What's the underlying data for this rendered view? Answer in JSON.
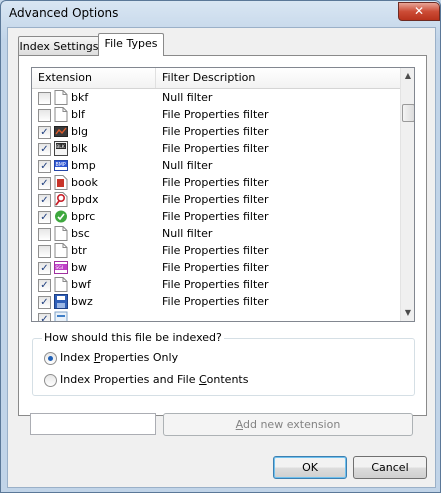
{
  "window": {
    "title": "Advanced Options",
    "close_symbol": "✕"
  },
  "tabs": [
    {
      "label": "Index Settings",
      "active": false
    },
    {
      "label": "File Types",
      "active": true
    }
  ],
  "list": {
    "header_extension": "Extension",
    "header_description": "Filter Description",
    "rows": [
      {
        "checked": false,
        "icon": "blank-file-icon",
        "ext": "bkf",
        "desc": "Null filter"
      },
      {
        "checked": false,
        "icon": "blank-file-icon",
        "ext": "blf",
        "desc": "File Properties filter"
      },
      {
        "checked": true,
        "icon": "blg-file-icon",
        "ext": "blg",
        "desc": "File Properties filter"
      },
      {
        "checked": true,
        "icon": "blk-file-icon",
        "ext": "blk",
        "desc": "File Properties filter"
      },
      {
        "checked": true,
        "icon": "bmp-file-icon",
        "ext": "bmp",
        "desc": "Null filter"
      },
      {
        "checked": true,
        "icon": "book-file-icon",
        "ext": "book",
        "desc": "File Properties filter"
      },
      {
        "checked": true,
        "icon": "bpdx-file-icon",
        "ext": "bpdx",
        "desc": "File Properties filter"
      },
      {
        "checked": true,
        "icon": "bprc-file-icon",
        "ext": "bprc",
        "desc": "File Properties filter"
      },
      {
        "checked": false,
        "icon": "blank-file-icon",
        "ext": "bsc",
        "desc": "Null filter"
      },
      {
        "checked": false,
        "icon": "blank-file-icon",
        "ext": "btr",
        "desc": "File Properties filter"
      },
      {
        "checked": true,
        "icon": "bw-file-icon",
        "ext": "bw",
        "desc": "File Properties filter"
      },
      {
        "checked": true,
        "icon": "blank-file-icon",
        "ext": "bwf",
        "desc": "File Properties filter"
      },
      {
        "checked": true,
        "icon": "bwz-file-icon",
        "ext": "bwz",
        "desc": "File Properties filter"
      },
      {
        "checked": true,
        "icon": "generic-file-icon",
        "ext": "",
        "desc": ""
      }
    ],
    "check_mark": "✓"
  },
  "index_group": {
    "legend": "How should this file be indexed?",
    "option1_pre": "Index ",
    "option1_u": "P",
    "option1_post": "roperties Only",
    "option2_pre": "Index Properties and File ",
    "option2_u": "C",
    "option2_post": "ontents",
    "selected": "option1"
  },
  "new_extension": {
    "value": "",
    "button_pre": "",
    "button_u": "A",
    "button_post": "dd new extension"
  },
  "footer": {
    "ok_label": "OK",
    "cancel_label": "Cancel"
  },
  "colors": {
    "accent": "#1f5fb5",
    "check": "#1f3f7f"
  }
}
